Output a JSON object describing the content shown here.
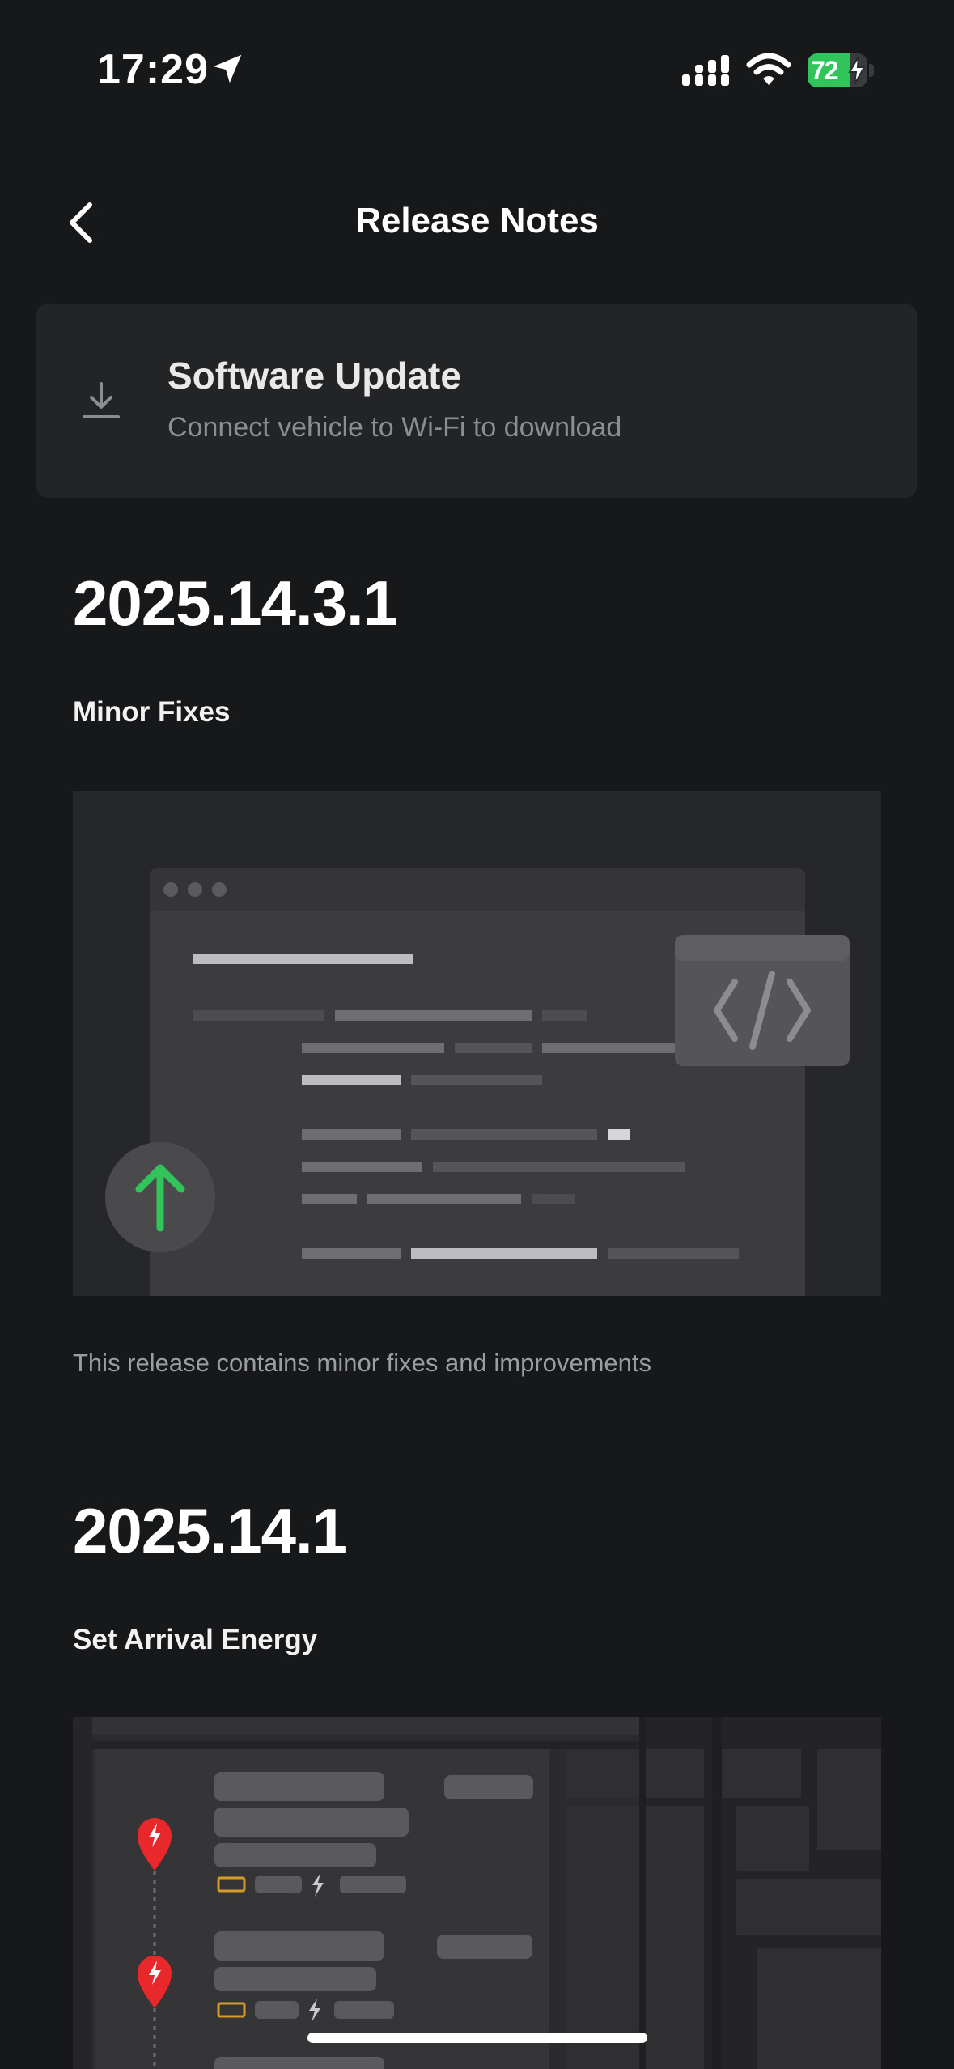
{
  "status_bar": {
    "time": "17:29",
    "battery_percent": "72",
    "battery_level": 0.72,
    "battery_color": "#31c45a",
    "icons": [
      "location-arrow-icon",
      "cellular-signal-icon",
      "wifi-icon",
      "battery-charging-icon"
    ]
  },
  "nav": {
    "back_icon": "chevron-left-icon",
    "title": "Release Notes"
  },
  "update_card": {
    "icon": "download-icon",
    "title": "Software Update",
    "subtitle": "Connect vehicle to Wi-Fi to download"
  },
  "releases": [
    {
      "version": "2025.14.3.1",
      "heading": "Minor Fixes",
      "illustration": "code-update-illustration",
      "description": "This release contains minor fixes and improvements"
    },
    {
      "version": "2025.14.1",
      "heading": "Set Arrival Energy",
      "illustration": "charging-route-map-illustration"
    }
  ],
  "colors": {
    "background": "#17181a",
    "card": "#232426",
    "accent_green": "#31c45a",
    "pin_red": "#e8282b"
  }
}
